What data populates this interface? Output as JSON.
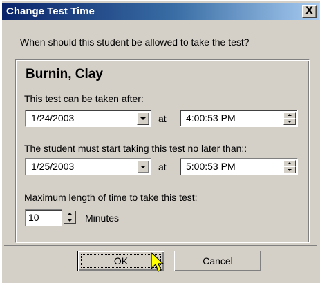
{
  "dialog": {
    "title": "Change Test Time",
    "close_label": "X",
    "question": "When should this student be allowed to take the test?"
  },
  "student": {
    "name": "Burnin, Clay"
  },
  "after": {
    "label": "This test can be taken after:",
    "date": "1/24/2003",
    "at": "at",
    "time": "4:00:53 PM"
  },
  "deadline": {
    "label": "The student must start taking this test no later than::",
    "date": "1/25/2003",
    "at": "at",
    "time": "5:00:53 PM"
  },
  "max_length": {
    "label": "Maximum length of time to take this test:",
    "value": "10",
    "unit": "Minutes"
  },
  "buttons": {
    "ok": "OK",
    "cancel": "Cancel"
  },
  "colors": {
    "face": "#d4d0c8",
    "title_start": "#0a246a",
    "title_end": "#a6caf0",
    "cursor": "#ffff00"
  },
  "icons": {
    "close": "close-icon",
    "dropdown": "chevron-down-icon",
    "spin": "spin-arrows-icon",
    "pointer": "mouse-pointer-icon"
  }
}
